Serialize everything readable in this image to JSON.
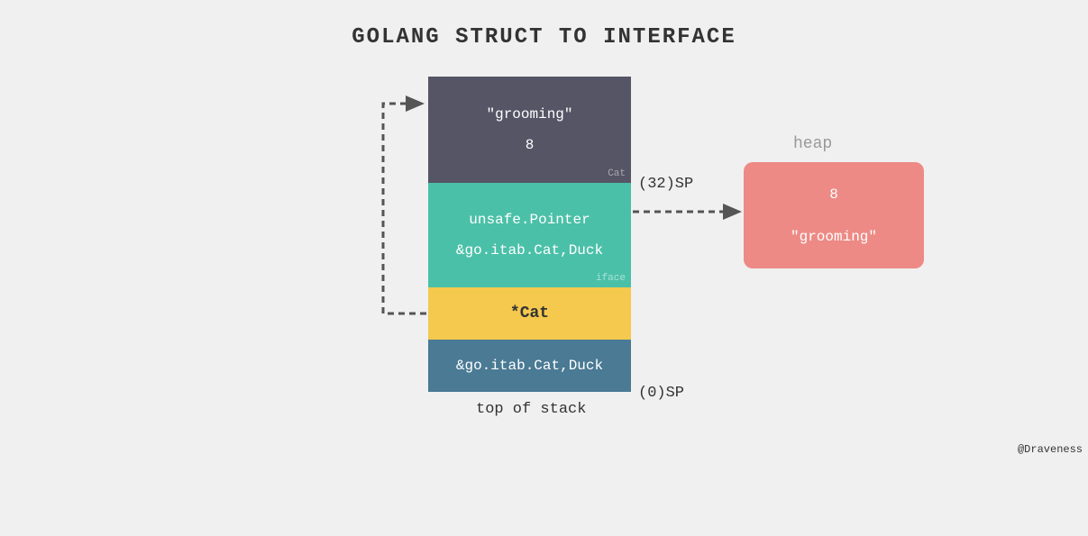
{
  "title": "GOLANG STRUCT TO INTERFACE",
  "stack": {
    "dark": {
      "line1": "\"grooming\"",
      "line2": "8",
      "corner": "Cat"
    },
    "teal": {
      "line1": "unsafe.Pointer",
      "line2": "&go.itab.Cat,Duck",
      "corner": "iface"
    },
    "yellow": {
      "line1": "*Cat"
    },
    "blue": {
      "line1": "&go.itab.Cat,Duck"
    }
  },
  "heap": {
    "label": "heap",
    "line1": "8",
    "line2": "\"grooming\""
  },
  "labels": {
    "sp32": "(32)SP",
    "sp0": "(0)SP",
    "top_of_stack": "top of stack"
  },
  "credit": "@Draveness"
}
